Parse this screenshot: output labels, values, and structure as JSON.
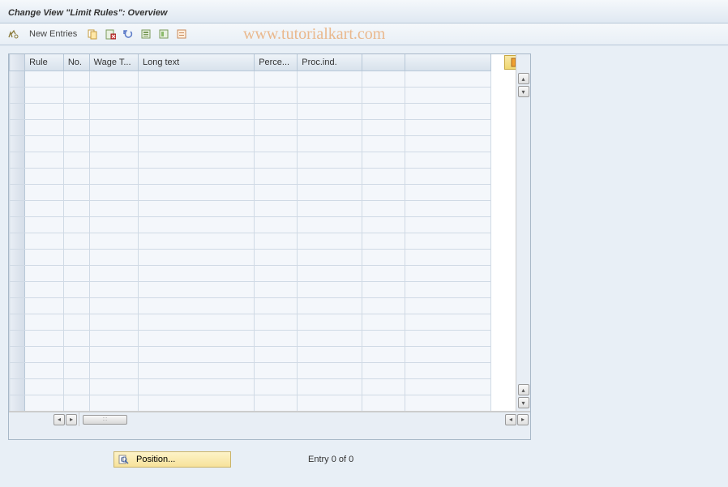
{
  "title": "Change View \"Limit Rules\": Overview",
  "toolbar": {
    "new_entries_label": "New Entries"
  },
  "watermark": "www.tutorialkart.com",
  "table": {
    "columns": {
      "rule": "Rule",
      "no": "No.",
      "wage": "Wage T...",
      "long": "Long text",
      "perce": "Perce...",
      "proc": "Proc.ind."
    },
    "rows": []
  },
  "footer": {
    "position_label": "Position...",
    "entry_text": "Entry 0 of 0"
  },
  "scroll_thumb_label": ":::"
}
